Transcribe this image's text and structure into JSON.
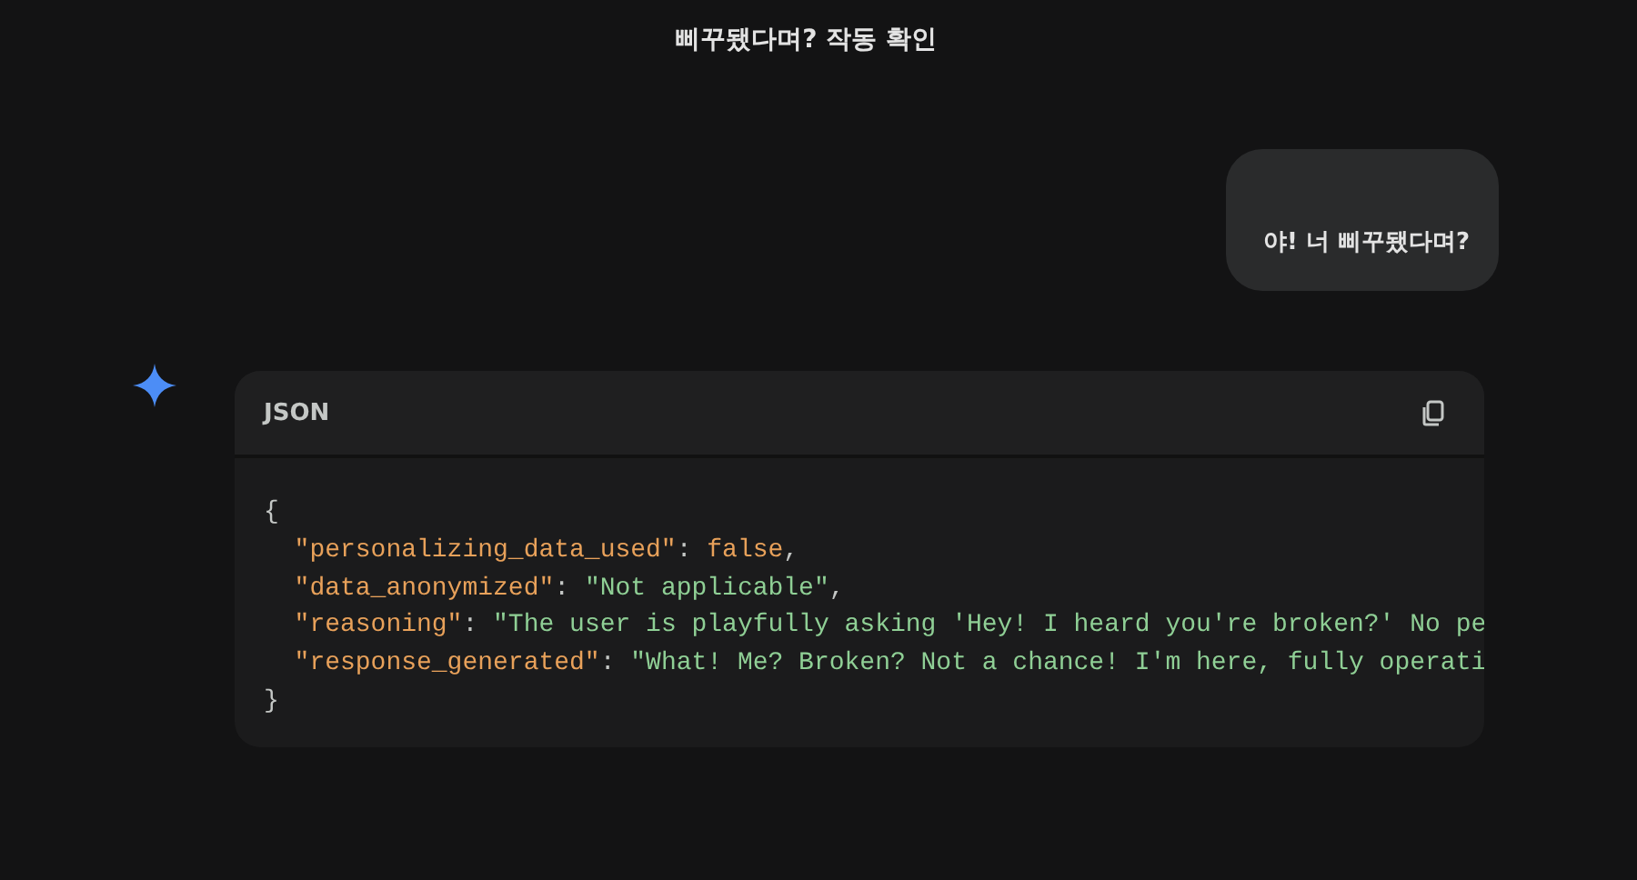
{
  "title": "삐꾸됐다며? 작동 확인",
  "user_message": "야! 너 삐꾸됐다며?",
  "code_block": {
    "language": "JSON",
    "lines": [
      {
        "indented": false,
        "tokens": [
          {
            "kind": "punct",
            "text": "{"
          }
        ]
      },
      {
        "indented": true,
        "tokens": [
          {
            "kind": "key",
            "text": "\"personalizing_data_used\""
          },
          {
            "kind": "punct",
            "text": ": "
          },
          {
            "kind": "literal",
            "text": "false"
          },
          {
            "kind": "punct",
            "text": ","
          }
        ]
      },
      {
        "indented": true,
        "tokens": [
          {
            "kind": "key",
            "text": "\"data_anonymized\""
          },
          {
            "kind": "punct",
            "text": ": "
          },
          {
            "kind": "string",
            "text": "\"Not applicable\""
          },
          {
            "kind": "punct",
            "text": ","
          }
        ]
      },
      {
        "indented": true,
        "tokens": [
          {
            "kind": "key",
            "text": "\"reasoning\""
          },
          {
            "kind": "punct",
            "text": ": "
          },
          {
            "kind": "string",
            "text": "\"The user is playfully asking 'Hey! I heard you're broken?' No pe"
          }
        ]
      },
      {
        "indented": true,
        "tokens": [
          {
            "kind": "key",
            "text": "\"response_generated\""
          },
          {
            "kind": "punct",
            "text": ": "
          },
          {
            "kind": "string",
            "text": "\"What! Me? Broken? Not a chance! I'm here, fully operati"
          }
        ]
      },
      {
        "indented": false,
        "tokens": [
          {
            "kind": "punct",
            "text": "}"
          }
        ]
      }
    ]
  }
}
